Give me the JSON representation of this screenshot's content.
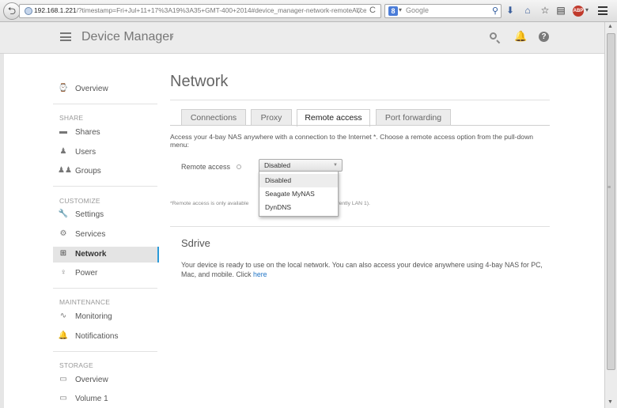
{
  "browser": {
    "url_host": "192.168.1.221",
    "url_rest": "/?timestamp=Fri+Jul+11+17%3A19%3A35+GMT-400+2014#device_manager-network-remoteAccessTab",
    "search_engine": "Google",
    "search_placeholder": "Google",
    "back_glyph": "⮌",
    "reload_glyph": "C"
  },
  "header": {
    "title": "Device Manager",
    "icons": [
      "search-icon",
      "bell-icon",
      "help-icon"
    ]
  },
  "sidebar": {
    "overview": "Overview",
    "sections": [
      {
        "heading": "SHARE",
        "items": [
          {
            "label": "Shares",
            "icon": "folder-icon"
          },
          {
            "label": "Users",
            "icon": "user-icon"
          },
          {
            "label": "Groups",
            "icon": "group-icon"
          }
        ]
      },
      {
        "heading": "CUSTOMIZE",
        "items": [
          {
            "label": "Settings",
            "icon": "wrench-icon"
          },
          {
            "label": "Services",
            "icon": "gear-icon"
          },
          {
            "label": "Network",
            "icon": "network-icon",
            "active": true
          },
          {
            "label": "Power",
            "icon": "bulb-icon"
          }
        ]
      },
      {
        "heading": "MAINTENANCE",
        "items": [
          {
            "label": "Monitoring",
            "icon": "pulse-icon"
          },
          {
            "label": "Notifications",
            "icon": "bell-icon"
          }
        ]
      },
      {
        "heading": "STORAGE",
        "items": [
          {
            "label": "Overview",
            "icon": "disk-icon"
          },
          {
            "label": "Volume 1",
            "icon": "disk-icon"
          }
        ]
      }
    ]
  },
  "main": {
    "title": "Network",
    "tabs": [
      "Connections",
      "Proxy",
      "Remote access",
      "Port forwarding"
    ],
    "active_tab": "Remote access",
    "description": "Access your 4-bay NAS anywhere with a connection to the Internet *. Choose a remote access option from the pull-down menu:",
    "remote_access_label": "Remote access",
    "select_value": "Disabled",
    "dropdown_options": [
      "Disabled",
      "Seagate MyNAS",
      "DynDNS"
    ],
    "note_left": "*Remote access is only available",
    "note_right": "rently LAN 1).",
    "sdrive_title": "Sdrive",
    "sdrive_text": "Your device is ready to use on the local network. You can also access your device anywhere using 4-bay NAS for PC, Mac, and mobile. Click",
    "sdrive_link": "here"
  },
  "colors": {
    "accent": "#2b9ad8",
    "link": "#2276c7"
  }
}
